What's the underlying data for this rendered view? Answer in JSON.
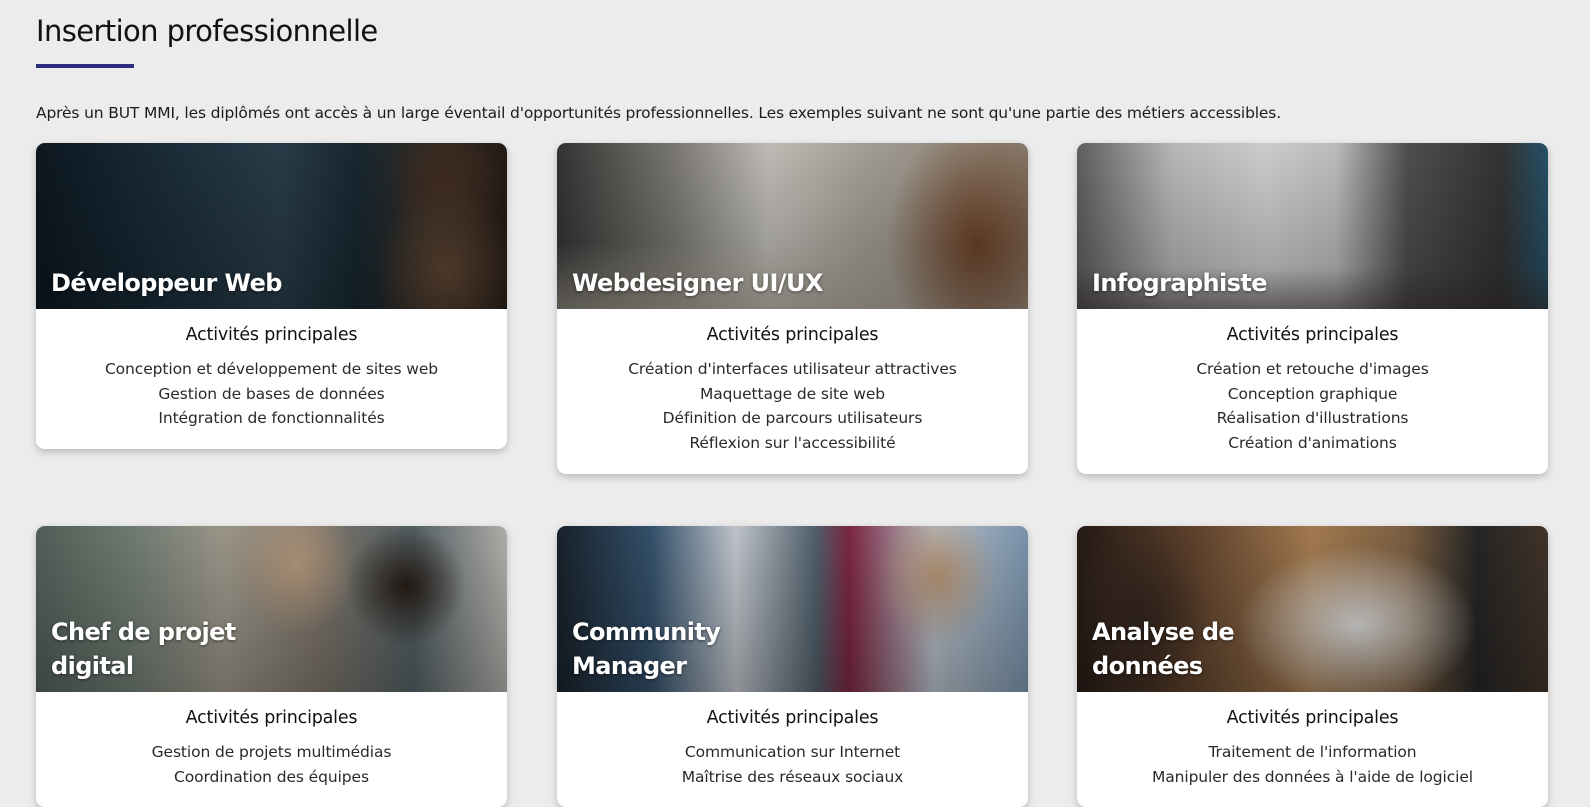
{
  "section": {
    "title": "Insertion professionnelle",
    "intro": "Après un BUT MMI, les diplômés ont accès à un large éventail d'opportunités professionnelles. Les exemples suivant ne sont qu'une partie des métiers accessibles."
  },
  "cards": [
    {
      "title": "Développeur Web",
      "subtitle": "Activités principales",
      "activities": [
        "Conception et développement de sites web",
        "Gestion de bases de données",
        "Intégration de fonctionnalités"
      ]
    },
    {
      "title": "Webdesigner UI/UX",
      "subtitle": "Activités principales",
      "activities": [
        "Création d'interfaces utilisateur attractives",
        "Maquettage de site web",
        "Définition de parcours utilisateurs",
        "Réflexion sur l'accessibilité"
      ]
    },
    {
      "title": "Infographiste",
      "subtitle": "Activités principales",
      "activities": [
        "Création et retouche d'images",
        "Conception graphique",
        "Réalisation d'illustrations",
        "Création d'animations"
      ]
    },
    {
      "title": "Chef de projet\ndigital",
      "subtitle": "Activités principales",
      "activities": [
        "Gestion de projets multimédias",
        "Coordination des équipes"
      ]
    },
    {
      "title": "Community\nManager",
      "subtitle": "Activités principales",
      "activities": [
        "Communication sur Internet",
        "Maîtrise des réseaux sociaux"
      ]
    },
    {
      "title": "Analyse de\ndonnées",
      "subtitle": "Activités principales",
      "activities": [
        "Traitement de l'information",
        "Manipuler des données à l'aide de logiciel"
      ]
    }
  ]
}
